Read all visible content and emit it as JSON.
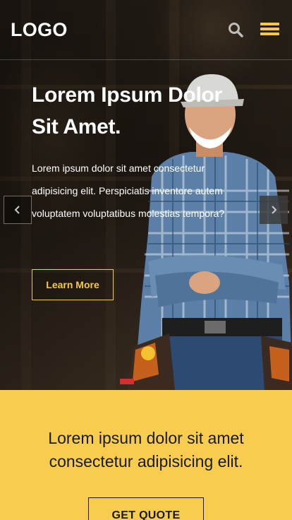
{
  "header": {
    "logo": "LOGO",
    "search_icon": "search-icon",
    "menu_icon": "hamburger-menu-icon"
  },
  "hero": {
    "title": "Lorem Ipsum Dolor Sit Amet.",
    "text": "Lorem ipsum dolor sit amet consectetur adipisicing elit. Perspiciatis inventore autem voluptatem voluptatibus molestias tempora?",
    "button_label": "Learn More",
    "prev_icon": "chevron-left-icon",
    "next_icon": "chevron-right-icon"
  },
  "cta": {
    "text": "Lorem ipsum dolor sit amet consectetur adipisicing elit.",
    "button_label": "GET QUOTE"
  },
  "colors": {
    "accent": "#f8cc4e",
    "hero_dark": "#231c15",
    "text_dark": "#1a1a1a"
  }
}
